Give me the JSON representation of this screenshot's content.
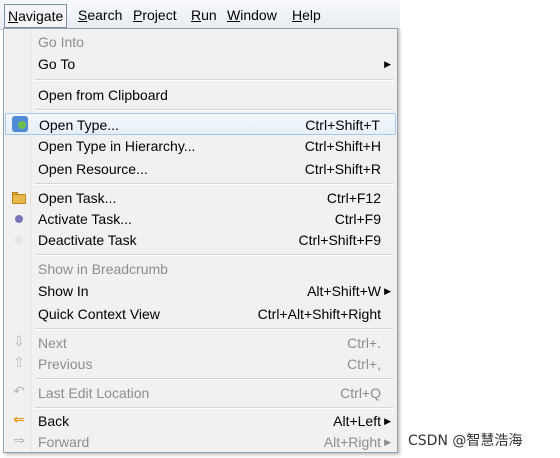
{
  "menubar": {
    "items": [
      "Navigate",
      "Search",
      "Project",
      "Run",
      "Window",
      "Help"
    ]
  },
  "menu": {
    "go_into": "Go Into",
    "go_to": "Go To",
    "open_from_clipboard": "Open from Clipboard",
    "open_type": {
      "label": "Open Type...",
      "accel": "Ctrl+Shift+T"
    },
    "open_type_hierarchy": {
      "label": "Open Type in Hierarchy...",
      "accel": "Ctrl+Shift+H"
    },
    "open_resource": {
      "label": "Open Resource...",
      "accel": "Ctrl+Shift+R"
    },
    "open_task": {
      "label": "Open Task...",
      "accel": "Ctrl+F12"
    },
    "activate_task": {
      "label": "Activate Task...",
      "accel": "Ctrl+F9"
    },
    "deactivate_task": {
      "label": "Deactivate Task",
      "accel": "Ctrl+Shift+F9"
    },
    "show_in_breadcrumb": "Show in Breadcrumb",
    "show_in": {
      "label": "Show In",
      "accel": "Alt+Shift+W"
    },
    "quick_context_view": {
      "label": "Quick Context View",
      "accel": "Ctrl+Alt+Shift+Right"
    },
    "next": {
      "label": "Next",
      "accel": "Ctrl+."
    },
    "previous": {
      "label": "Previous",
      "accel": "Ctrl+,"
    },
    "last_edit_location": {
      "label": "Last Edit Location",
      "accel": "Ctrl+Q"
    },
    "back": {
      "label": "Back",
      "accel": "Alt+Left"
    },
    "forward": {
      "label": "Forward",
      "accel": "Alt+Right"
    }
  },
  "watermark": "CSDN @智慧浩海"
}
